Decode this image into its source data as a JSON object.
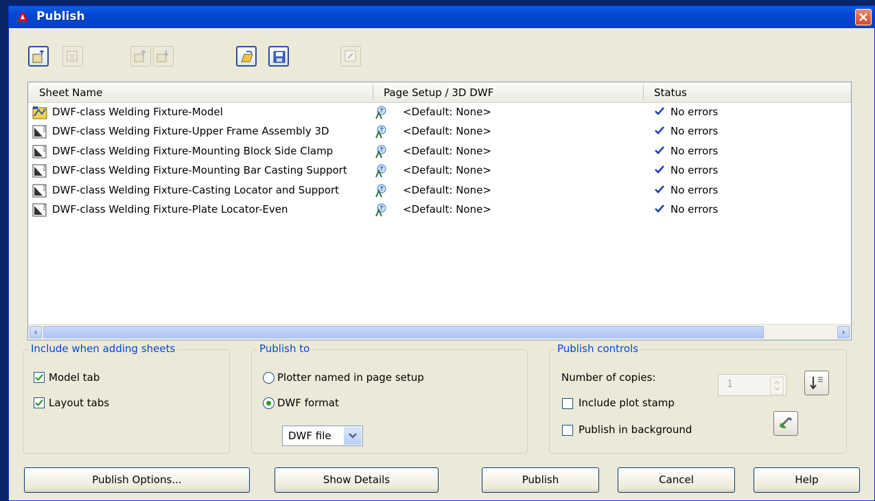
{
  "window": {
    "title": "Publish"
  },
  "grid": {
    "columns": [
      "Sheet Name",
      "Page Setup / 3D DWF",
      "Status"
    ],
    "rows": [
      {
        "name": "DWF-class Welding Fixture-Model",
        "setup": "<Default: None>",
        "status": "No errors",
        "type": "model"
      },
      {
        "name": "DWF-class Welding Fixture-Upper Frame Assembly 3D",
        "setup": "<Default: None>",
        "status": "No errors",
        "type": "layout"
      },
      {
        "name": "DWF-class Welding Fixture-Mounting Block Side Clamp",
        "setup": "<Default: None>",
        "status": "No errors",
        "type": "layout"
      },
      {
        "name": "DWF-class Welding Fixture-Mounting Bar Casting Support",
        "setup": "<Default: None>",
        "status": "No errors",
        "type": "layout"
      },
      {
        "name": "DWF-class Welding Fixture-Casting Locator and Support",
        "setup": "<Default: None>",
        "status": "No errors",
        "type": "layout"
      },
      {
        "name": "DWF-class Welding Fixture-Plate Locator-Even",
        "setup": "<Default: None>",
        "status": "No errors",
        "type": "layout"
      }
    ]
  },
  "include_group": {
    "title": "Include when adding sheets",
    "model_tab": "Model tab",
    "layout_tabs": "Layout tabs",
    "model_checked": true,
    "layout_checked": true
  },
  "publish_to": {
    "title": "Publish to",
    "plotter": "Plotter named in page setup",
    "dwf": "DWF format",
    "selected": "dwf",
    "format_value": "DWF file"
  },
  "controls": {
    "title": "Publish controls",
    "copies_label": "Number of copies:",
    "copies_value": "1",
    "plot_stamp": "Include plot stamp",
    "background": "Publish in background"
  },
  "buttons": {
    "options": "Publish Options...",
    "details": "Show Details",
    "publish": "Publish",
    "cancel": "Cancel",
    "help": "Help"
  },
  "colors": {
    "titlebar": "#0446d2",
    "group_title": "#0046d5",
    "check": "#1a3fb0"
  }
}
